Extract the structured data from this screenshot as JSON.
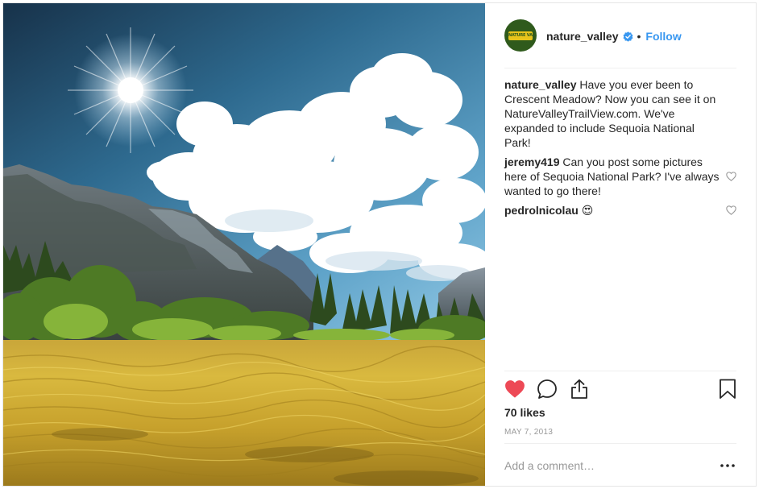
{
  "post": {
    "image_alt": "Mountain meadow with golden grass, pine forest, granite peaks, white clouds and bright sun"
  },
  "header": {
    "username": "nature_valley",
    "avatar_logo_text": "NATURE VALLEY",
    "separator": "•",
    "follow_label": "Follow"
  },
  "comments": [
    {
      "author": "nature_valley",
      "text": "Have you ever been to Crescent Meadow? Now you can see it on NatureValleyTrailView.com. We've expanded to include Sequoia National Park!",
      "likeable": false
    },
    {
      "author": "jeremy419",
      "text": "Can you post some pictures here of Sequoia National Park? I've always wanted to go there!",
      "likeable": true
    },
    {
      "author": "pedrolnicolau",
      "text": "😍",
      "likeable": true
    }
  ],
  "likes_text": "70 likes",
  "date_text": "MAY 7, 2013",
  "add_comment": {
    "placeholder": "Add a comment…",
    "value": ""
  },
  "colors": {
    "link_blue": "#3897f0",
    "like_red": "#ed4956",
    "verified_blue": "#3897f0",
    "muted": "#999999",
    "avatar_green": "#2f5a1c",
    "avatar_yellow": "#e8c41b"
  }
}
